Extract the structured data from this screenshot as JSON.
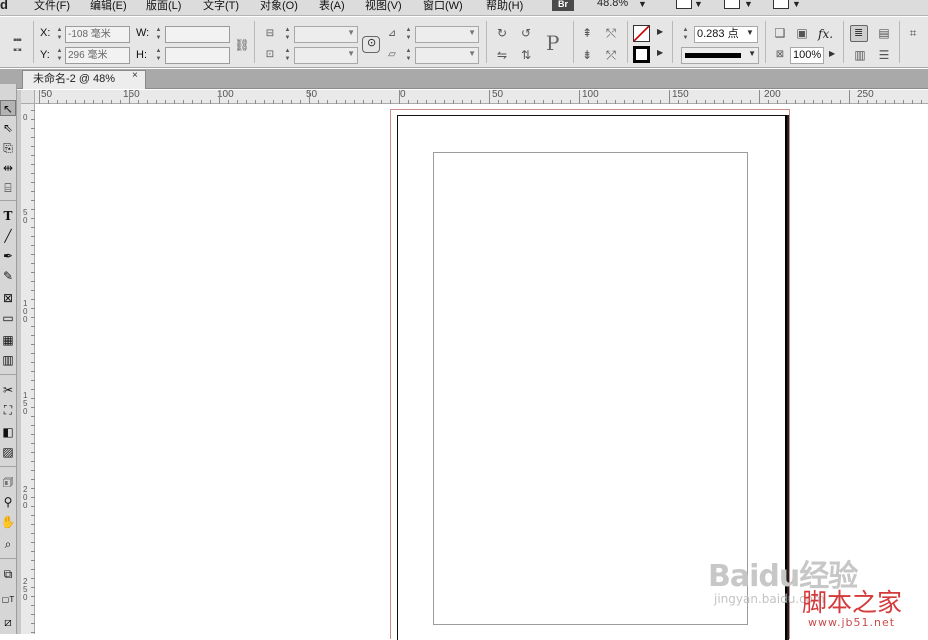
{
  "menu": {
    "app_logo": "d",
    "items": [
      "文件(F)",
      "编辑(E)",
      "版面(L)",
      "文字(T)",
      "对象(O)",
      "表(A)",
      "视图(V)",
      "窗口(W)",
      "帮助(H)"
    ],
    "bridge_label": "Br",
    "zoom_level": "48.8%"
  },
  "control": {
    "x_label": "X:",
    "y_label": "Y:",
    "w_label": "W:",
    "h_label": "H:",
    "x_value": "-108 毫米",
    "y_value": "296 毫米",
    "stroke_weight": "0.283 点",
    "opacity": "100%",
    "ref_point_glyph": "P",
    "fx_label": "fx."
  },
  "document": {
    "tab_title": "未命名-2 @ 48%",
    "close_glyph": "×"
  },
  "ruler": {
    "h_labels": [
      "50",
      "150",
      "100",
      "50",
      "0",
      "50",
      "100",
      "150",
      "200",
      "250"
    ],
    "v_labels": [
      "0",
      "5\n0",
      "1\n0\n0",
      "1\n5\n0",
      "2\n0\n0",
      "2\n5\n0"
    ]
  },
  "watermark": {
    "baidu_text": "Baidu经验",
    "baidu_url": "jingyan.baidu.com",
    "jb51_text": "脚本之家",
    "jb51_url": "www.jb51.net"
  }
}
